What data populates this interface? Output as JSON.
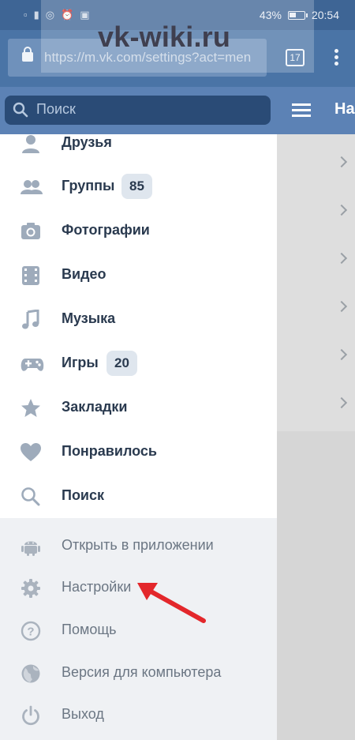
{
  "status_bar": {
    "left_icons": [
      "sim-icon",
      "signal-icon",
      "wifi-icon",
      "alarm-icon",
      "activity-icon"
    ],
    "battery_percent": "43%",
    "time": "20:54"
  },
  "watermark": {
    "text": "vk-wiki.ru"
  },
  "browser": {
    "url": "https://m.vk.com/settings?act=men",
    "tabs_count": "17"
  },
  "header": {
    "search_placeholder": "Поиск",
    "title": "На"
  },
  "menu": {
    "items": [
      {
        "label": "Друзья",
        "icon": "friends-icon"
      },
      {
        "label": "Группы",
        "icon": "groups-icon",
        "badge": "85"
      },
      {
        "label": "Фотографии",
        "icon": "camera-icon"
      },
      {
        "label": "Видео",
        "icon": "video-icon"
      },
      {
        "label": "Музыка",
        "icon": "music-icon"
      },
      {
        "label": "Игры",
        "icon": "gamepad-icon",
        "badge": "20"
      },
      {
        "label": "Закладки",
        "icon": "star-icon"
      },
      {
        "label": "Понравилось",
        "icon": "heart-icon"
      },
      {
        "label": "Поиск",
        "icon": "search-icon"
      }
    ],
    "secondary": [
      {
        "label": "Открыть в приложении",
        "icon": "android-icon"
      },
      {
        "label": "Настройки",
        "icon": "gear-icon"
      },
      {
        "label": "Помощь",
        "icon": "help-icon"
      },
      {
        "label": "Версия для компьютера",
        "icon": "globe-icon"
      },
      {
        "label": "Выход",
        "icon": "power-icon"
      }
    ]
  },
  "colors": {
    "status_bar": "#3e6595",
    "header": "#5c82b5",
    "search_bar": "#2a4b76",
    "arrow": "#e3272b"
  }
}
